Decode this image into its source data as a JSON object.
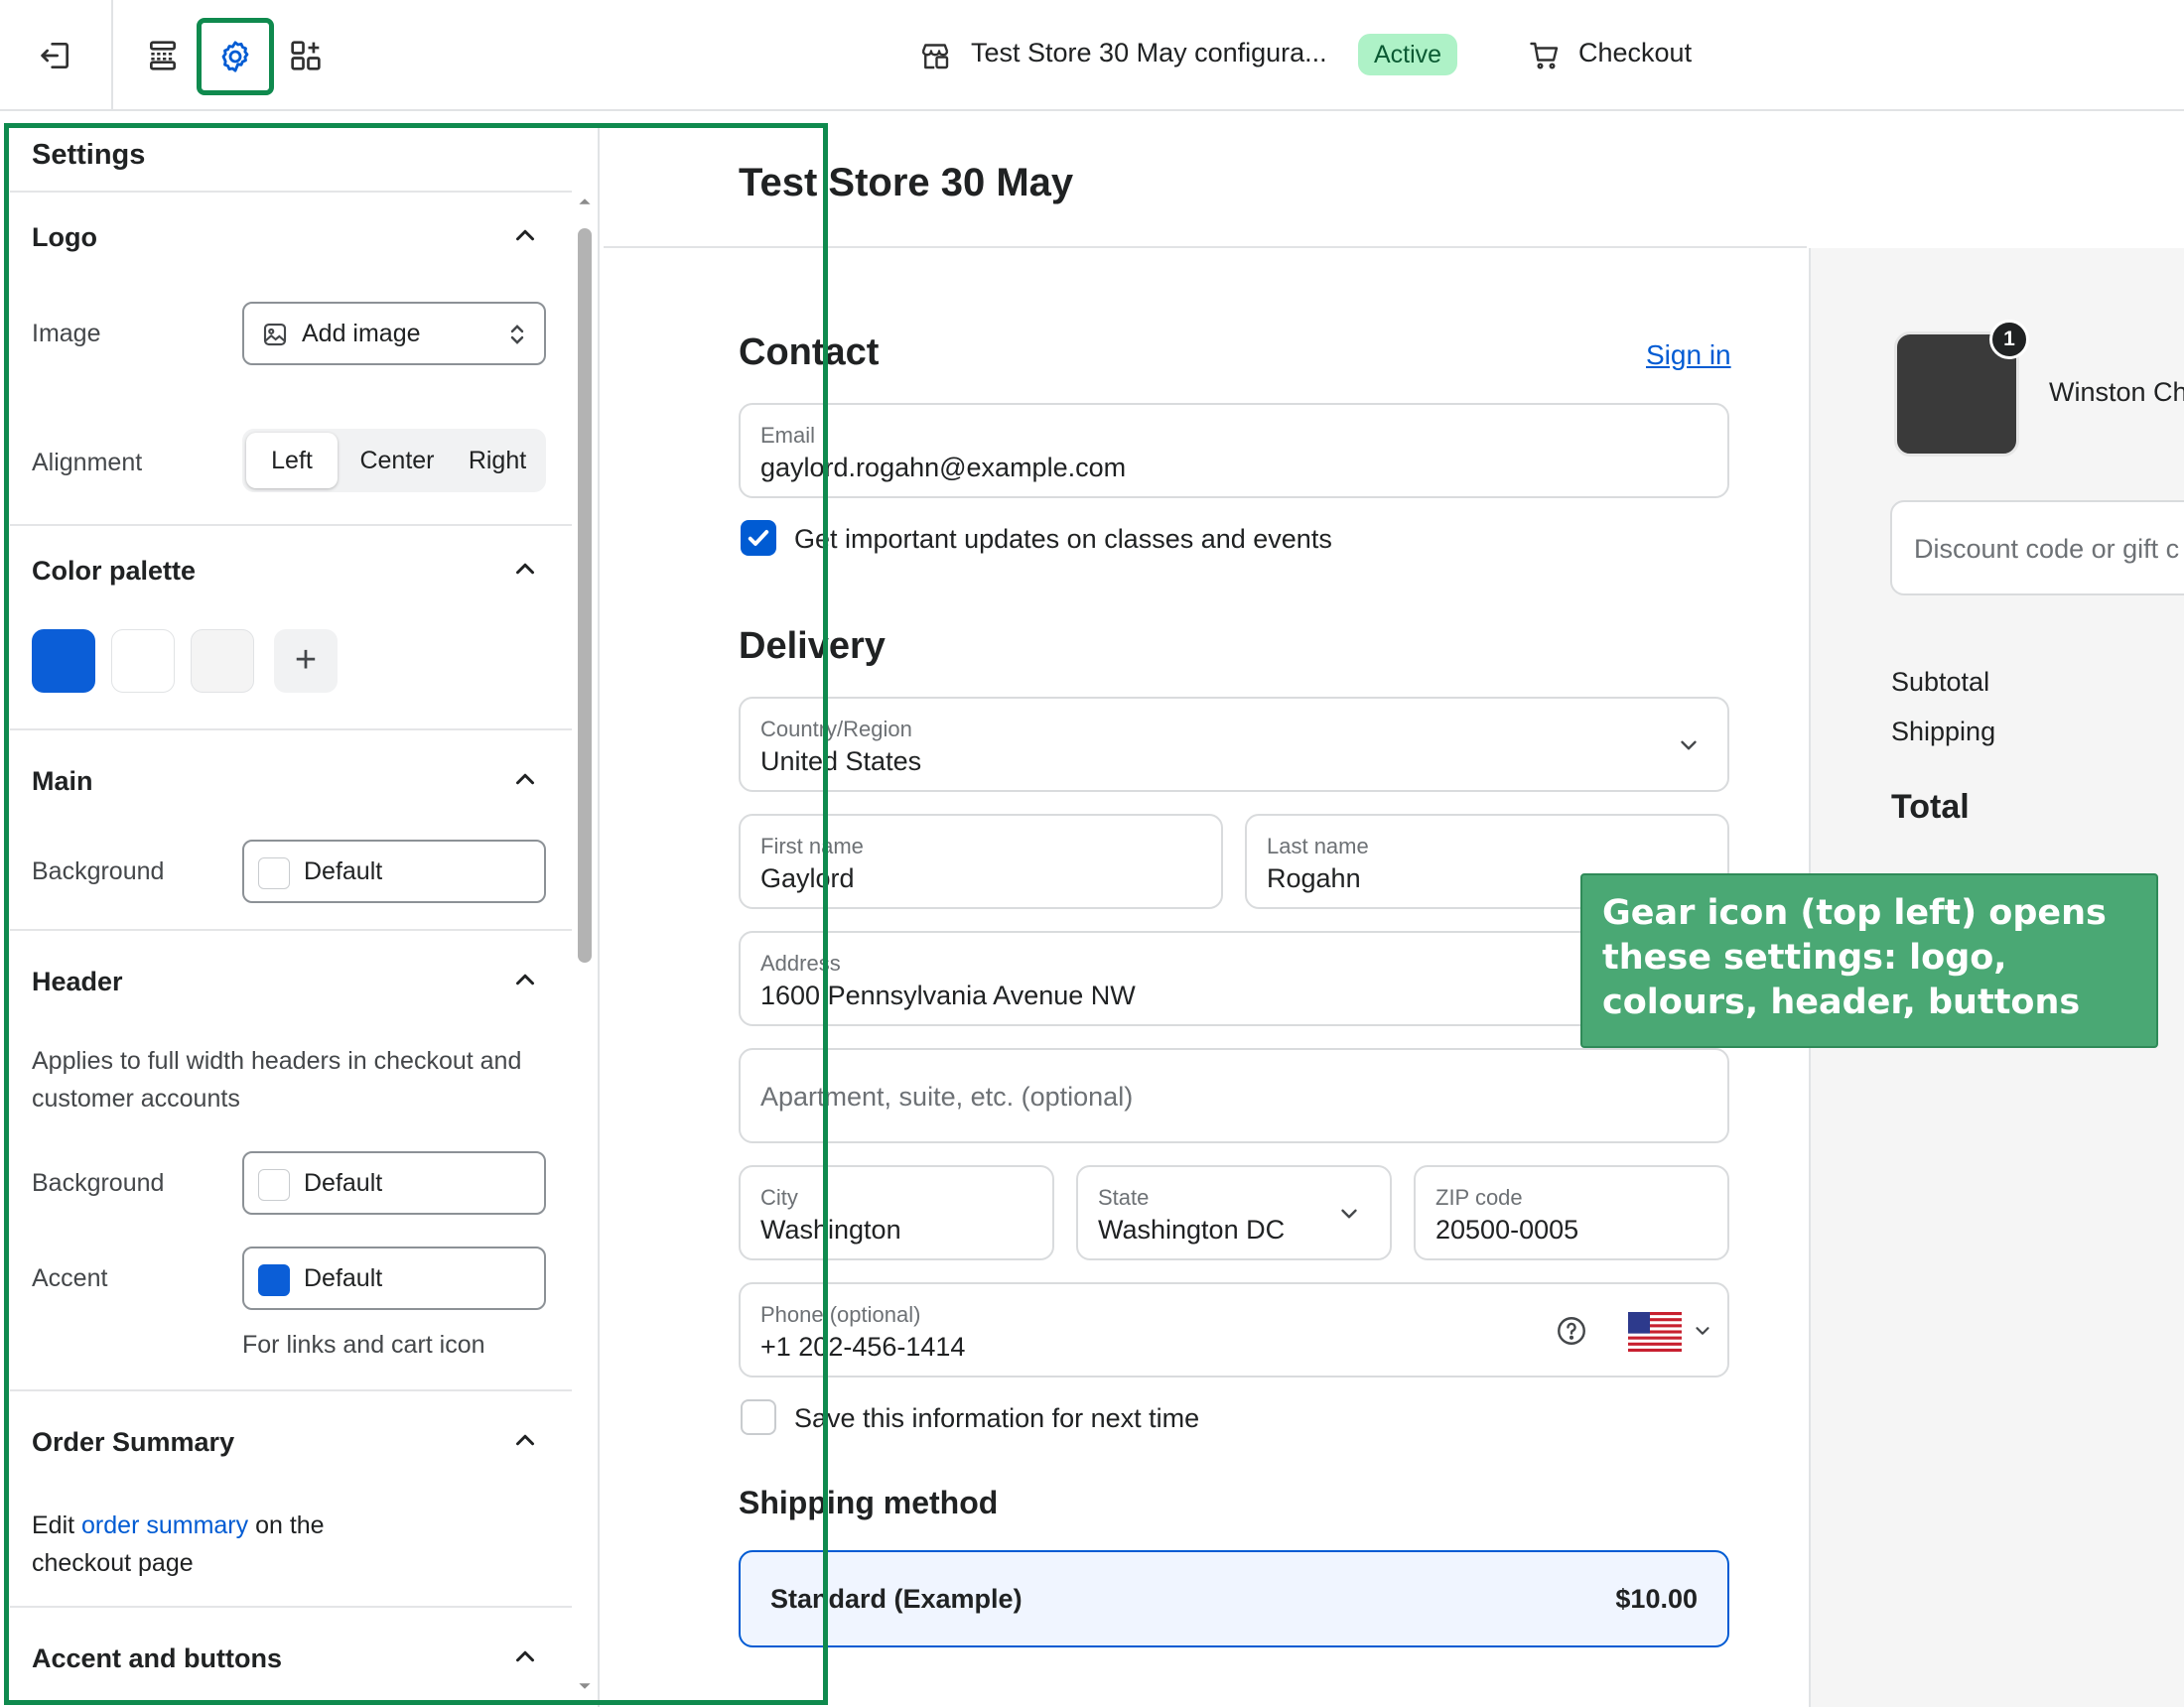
{
  "topbar": {
    "store_title": "Test Store 30 May configura...",
    "status_badge": "Active",
    "checkout_label": "Checkout",
    "icons": [
      "exit-icon",
      "layout-sections-icon",
      "gear-icon",
      "apps-icon",
      "store-icon",
      "cart-icon"
    ]
  },
  "settings": {
    "title": "Settings",
    "logo": {
      "title": "Logo",
      "image_label": "Image",
      "image_value": "Add image",
      "alignment_label": "Alignment",
      "alignment_options": [
        "Left",
        "Center",
        "Right"
      ],
      "alignment_selected": "Left"
    },
    "color_palette": {
      "title": "Color palette",
      "swatches": [
        "#0b5ed7",
        "#ffffff",
        "#f4f4f4"
      ],
      "add_label": "+"
    },
    "main": {
      "title": "Main",
      "background_label": "Background",
      "background_value": "Default"
    },
    "header": {
      "title": "Header",
      "description": "Applies to full width headers in checkout and customer accounts",
      "background_label": "Background",
      "background_value": "Default",
      "accent_label": "Accent",
      "accent_value": "Default",
      "accent_color": "#0b5ed7",
      "accent_help": "For links and cart icon"
    },
    "order_summary": {
      "title": "Order Summary",
      "text_before": "Edit ",
      "link_text": "order summary",
      "text_after": " on the checkout page"
    },
    "accent_buttons": {
      "title": "Accent and buttons"
    }
  },
  "checkout": {
    "shop_name": "Test Store 30 May",
    "contact": {
      "title": "Contact",
      "sign_in": "Sign in",
      "email_label": "Email",
      "email_value": "gaylord.rogahn@example.com",
      "updates_label": "Get important updates on classes and events",
      "updates_checked": true
    },
    "delivery": {
      "title": "Delivery",
      "country_label": "Country/Region",
      "country_value": "United States",
      "first_name_label": "First name",
      "first_name_value": "Gaylord",
      "last_name_label": "Last name",
      "last_name_value": "Rogahn",
      "address_label": "Address",
      "address_value": "1600 Pennsylvania Avenue NW",
      "apartment_placeholder": "Apartment, suite, etc. (optional)",
      "city_label": "City",
      "city_value": "Washington",
      "state_label": "State",
      "state_value": "Washington DC",
      "zip_label": "ZIP code",
      "zip_value": "20500-0005",
      "phone_label": "Phone (optional)",
      "phone_value": "+1 202-456-1414",
      "save_info_label": "Save this information for next time",
      "save_info_checked": false
    },
    "shipping": {
      "title": "Shipping method",
      "option_name": "Standard (Example)",
      "option_price": "$10.00"
    }
  },
  "summary": {
    "product_name": "Winston Ch",
    "quantity": "1",
    "discount_placeholder": "Discount code or gift c",
    "subtotal_label": "Subtotal",
    "shipping_label": "Shipping",
    "total_label": "Total"
  },
  "callout": {
    "text": "Gear icon (top left) opens these settings: logo, colours, header, buttons"
  },
  "colors": {
    "highlight": "#0f8a4e",
    "accent_blue": "#005bd3",
    "badge_green": "#aef2c7",
    "callout_bg": "#4aa874"
  }
}
